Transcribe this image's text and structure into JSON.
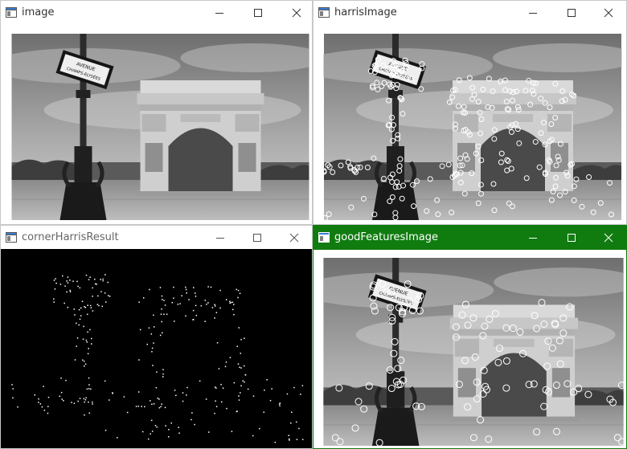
{
  "windows": {
    "image": {
      "title": "image"
    },
    "harris": {
      "title": "harrisImage"
    },
    "corner": {
      "title": "cornerHarrisResult"
    },
    "good": {
      "title": "goodFeaturesImage"
    }
  },
  "photo": {
    "sign_line1": "AVENUE",
    "sign_line2": "CHAMPS-ELYSÉES"
  },
  "colors": {
    "active_title": "#107c10",
    "window_border": "#c8c8c8"
  }
}
